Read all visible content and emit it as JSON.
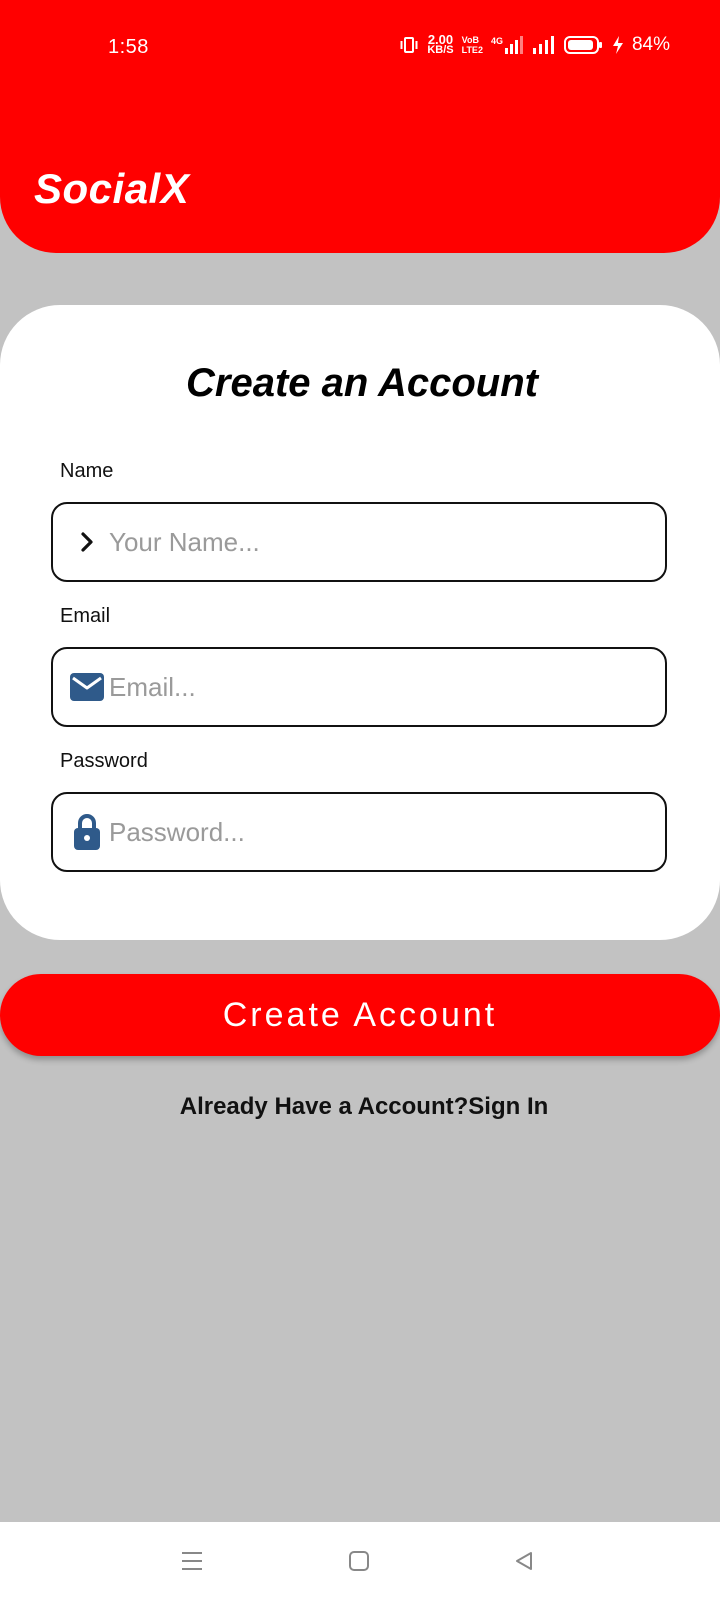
{
  "status_bar": {
    "time": "1:58",
    "net_speed_value": "2.00",
    "net_speed_unit": "KB/S",
    "volte_top": "VoB",
    "volte_bottom": "LTE2",
    "network_type": "4G",
    "battery_percent": "84%"
  },
  "header": {
    "app_name": "SocialX",
    "background_color": "#ff0000"
  },
  "form": {
    "title": "Create an Account",
    "fields": [
      {
        "label": "Name",
        "placeholder": "Your Name...",
        "value": "",
        "icon": "chevron-right-icon"
      },
      {
        "label": "Email",
        "placeholder": "Email...",
        "value": "",
        "icon": "envelope-icon"
      },
      {
        "label": "Password",
        "placeholder": "Password...",
        "value": "",
        "icon": "lock-icon"
      }
    ],
    "icon_color": "#2f5a8a"
  },
  "actions": {
    "create_button": "Create Account",
    "signin_prompt": "Already Have a Account?Sign In"
  },
  "navigation_bar": {
    "buttons": [
      "menu-icon",
      "home-icon",
      "back-icon"
    ]
  },
  "colors": {
    "accent": "#ff0000",
    "page_background": "#c2c2c2",
    "card_background": "#ffffff"
  }
}
